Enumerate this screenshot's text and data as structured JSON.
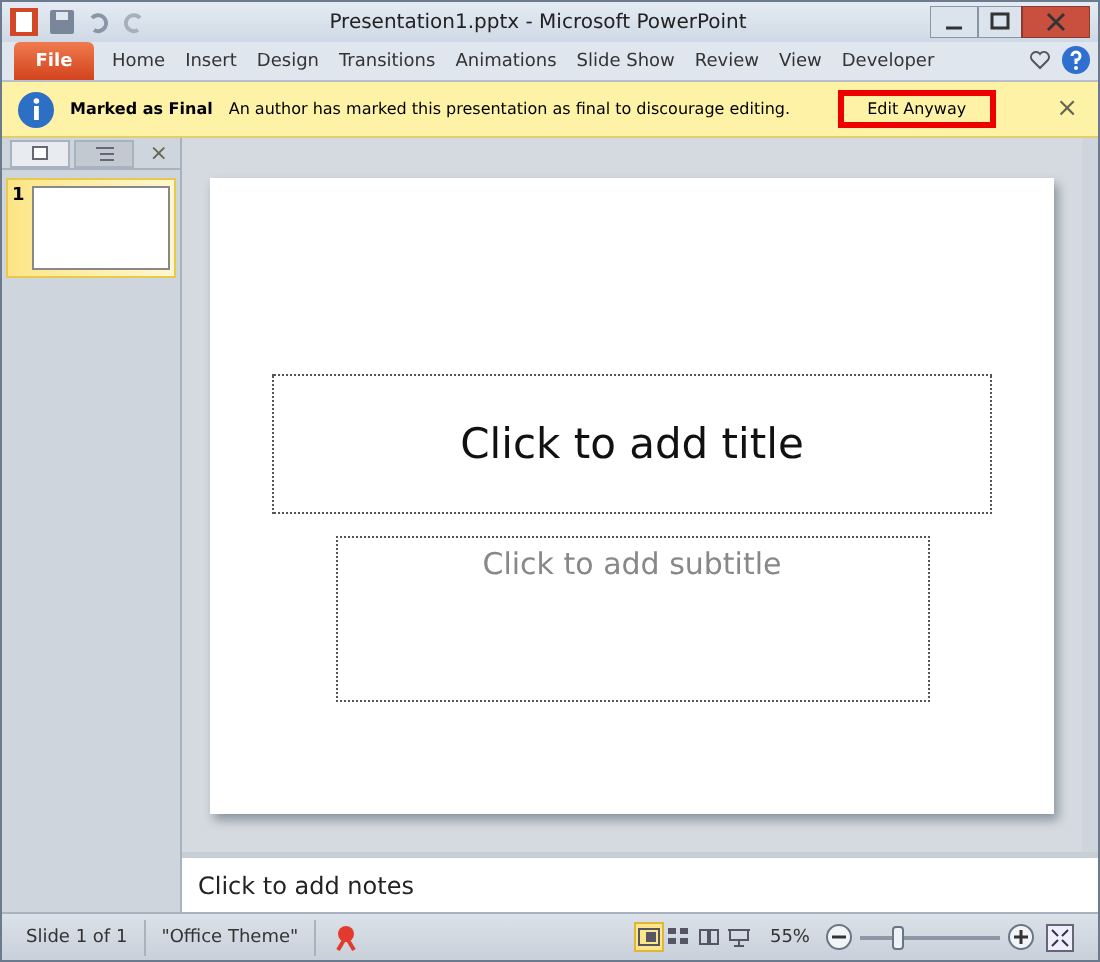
{
  "window": {
    "title": "Presentation1.pptx - Microsoft PowerPoint"
  },
  "tabs": [
    {
      "label": "File",
      "kind": "file"
    },
    {
      "label": "Home",
      "kind": "tab"
    },
    {
      "label": "Insert",
      "kind": "tab"
    },
    {
      "label": "Design",
      "kind": "tab"
    },
    {
      "label": "Transitions",
      "kind": "tab"
    },
    {
      "label": "Animations",
      "kind": "tab"
    },
    {
      "label": "Slide Show",
      "kind": "tab"
    },
    {
      "label": "Review",
      "kind": "tab"
    },
    {
      "label": "View",
      "kind": "tab"
    },
    {
      "label": "Developer",
      "kind": "tab"
    }
  ],
  "message_bar": {
    "title": "Marked as Final",
    "text": "An author has marked this presentation as final to discourage editing.",
    "button": "Edit Anyway",
    "close": "×"
  },
  "side_panel": {
    "close": "×",
    "slides": [
      {
        "number": "1",
        "selected": true
      }
    ]
  },
  "slide": {
    "title_placeholder": "Click to add title",
    "subtitle_placeholder": "Click to add subtitle"
  },
  "notes": {
    "placeholder": "Click to add notes"
  },
  "status_bar": {
    "slide": "Slide 1 of 1",
    "theme": "\"Office Theme\"",
    "zoom": "55%",
    "level": 0.27,
    "views": [
      {
        "kind": "normal",
        "selected": true
      },
      {
        "kind": "sorter",
        "selected": false
      },
      {
        "kind": "reading",
        "selected": false
      },
      {
        "kind": "slideshow",
        "selected": false
      }
    ]
  }
}
